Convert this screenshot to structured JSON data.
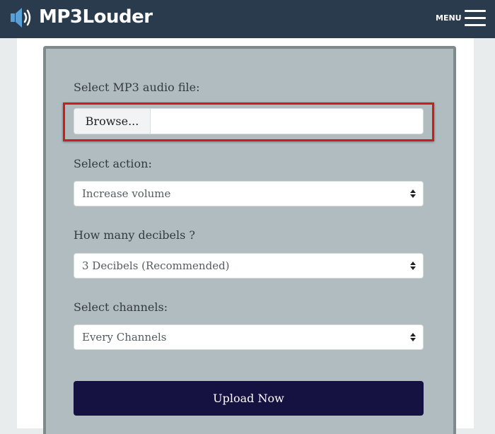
{
  "header": {
    "brand": "MP3Louder",
    "menu_label": "MENU",
    "icons": {
      "logo": "speaker-icon",
      "menu": "hamburger-icon"
    },
    "colors": {
      "background": "#2b3b4e",
      "brand_icon": "#5aa0d6"
    }
  },
  "form": {
    "file": {
      "label": "Select MP3 audio file:",
      "button": "Browse..."
    },
    "action": {
      "label": "Select action:",
      "selected": "Increase volume"
    },
    "decibels": {
      "label": "How many decibels ?",
      "selected": "3 Decibels (Recommended)"
    },
    "channels": {
      "label": "Select channels:",
      "selected": "Every Channels"
    },
    "submit": "Upload Now",
    "colors": {
      "panel": "#b0bcbf",
      "submit": "#151141",
      "highlight": "#d11a1a"
    }
  }
}
